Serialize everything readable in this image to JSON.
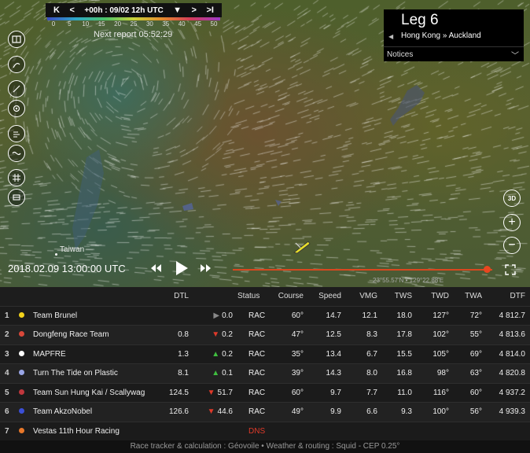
{
  "timebar": {
    "first_label": "K",
    "prev_label": "<",
    "time_label": "+00h : 09/02 12h UTC",
    "dropdown_label": "▼",
    "next_label": ">",
    "last_label": ">I"
  },
  "wind_scale": {
    "ticks": [
      "0",
      "5",
      "10",
      "15",
      "20",
      "25",
      "30",
      "35",
      "40",
      "45",
      "50"
    ]
  },
  "next_report": "Next report 05:52:29",
  "leg": {
    "title": "Leg 6",
    "route": "Hong Kong » Auckland",
    "arrow": "◀"
  },
  "notices": {
    "label": "Notices",
    "chevron": "﹀"
  },
  "map": {
    "label": "Taiwan",
    "coordinates": "23°55.57'N • 129°22.88'E",
    "boat_color": "#e8df2a"
  },
  "playback": {
    "datetime": "2018.02.09 13:00:00 UTC",
    "progress": 0.98
  },
  "right_controls": {
    "btn_3d": "3D",
    "zoom_in": "+",
    "zoom_out": "−"
  },
  "table": {
    "headers": [
      "DTL",
      "Status",
      "Course",
      "Speed",
      "VMG",
      "TWS",
      "TWD",
      "TWA",
      "DTF"
    ],
    "rows": [
      {
        "rank": "1",
        "color": "#f2d21b",
        "team": "Team Brunel",
        "dtl": "",
        "trend": "▶",
        "trend_dir": "flat",
        "delta": "0.0",
        "status": "RAC",
        "course": "60°",
        "speed": "14.7",
        "vmg": "12.1",
        "tws": "18.0",
        "twd": "127°",
        "twa": "72°",
        "dtf": "4 812.7"
      },
      {
        "rank": "2",
        "color": "#d9483a",
        "team": "Dongfeng Race Team",
        "dtl": "0.8",
        "trend": "▼",
        "trend_dir": "down",
        "delta": "0.2",
        "status": "RAC",
        "course": "47°",
        "speed": "12.5",
        "vmg": "8.3",
        "tws": "17.8",
        "twd": "102°",
        "twa": "55°",
        "dtf": "4 813.6"
      },
      {
        "rank": "3",
        "color": "#ffffff",
        "team": "MAPFRE",
        "dtl": "1.3",
        "trend": "▲",
        "trend_dir": "up",
        "delta": "0.2",
        "status": "RAC",
        "course": "35°",
        "speed": "13.4",
        "vmg": "6.7",
        "tws": "15.5",
        "twd": "105°",
        "twa": "69°",
        "dtf": "4 814.0"
      },
      {
        "rank": "4",
        "color": "#9aa6e6",
        "team": "Turn The Tide on Plastic",
        "dtl": "8.1",
        "trend": "▲",
        "trend_dir": "up",
        "delta": "0.1",
        "status": "RAC",
        "course": "39°",
        "speed": "14.3",
        "vmg": "8.0",
        "tws": "16.8",
        "twd": "98°",
        "twa": "63°",
        "dtf": "4 820.8"
      },
      {
        "rank": "5",
        "color": "#c0373d",
        "team": "Team Sun Hung Kai / Scallywag",
        "dtl": "124.5",
        "trend": "▼",
        "trend_dir": "down",
        "delta": "51.7",
        "status": "RAC",
        "course": "60°",
        "speed": "9.7",
        "vmg": "7.7",
        "tws": "11.0",
        "twd": "116°",
        "twa": "60°",
        "dtf": "4 937.2"
      },
      {
        "rank": "6",
        "color": "#3b4fd6",
        "team": "Team AkzoNobel",
        "dtl": "126.6",
        "trend": "▼",
        "trend_dir": "down",
        "delta": "44.6",
        "status": "RAC",
        "course": "49°",
        "speed": "9.9",
        "vmg": "6.6",
        "tws": "9.3",
        "twd": "100°",
        "twa": "56°",
        "dtf": "4 939.3"
      },
      {
        "rank": "7",
        "color": "#e8782a",
        "team": "Vestas 11th Hour Racing",
        "dtl": "",
        "trend": "",
        "trend_dir": "flat",
        "delta": "",
        "status": "DNS",
        "course": "",
        "speed": "",
        "vmg": "",
        "tws": "",
        "twd": "",
        "twa": "",
        "dtf": ""
      }
    ]
  },
  "footer": "Race tracker & calculation : Géovoile • Weather & routing : Squid - CEP 0.25°"
}
